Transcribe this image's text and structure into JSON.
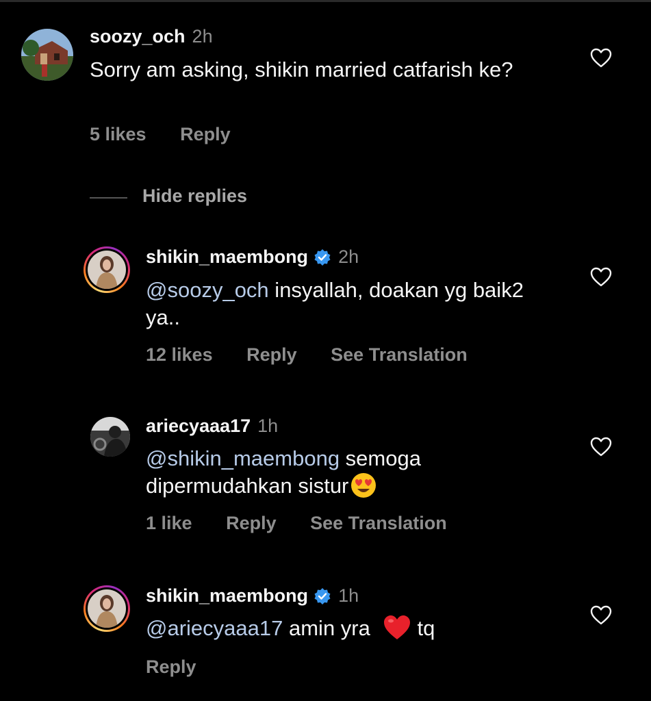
{
  "comments": [
    {
      "username": "soozy_och",
      "time": "2h",
      "text": "Sorry am asking, shikin married catfarish ke?",
      "likes": "5 likes",
      "reply": "Reply"
    },
    {
      "username": "shikin_maembong",
      "time": "2h",
      "mention": "@soozy_och",
      "text": " insyallah, doakan yg baik2 ya..",
      "likes": "12 likes",
      "reply": "Reply",
      "translate": "See Translation"
    },
    {
      "username": "ariecyaaa17",
      "time": "1h",
      "mention": "@shikin_maembong",
      "text": " semoga dipermudahkan sistur",
      "likes": "1 like",
      "reply": "Reply",
      "translate": "See Translation"
    },
    {
      "username": "shikin_maembong",
      "time": "1h",
      "mention": "@ariecyaaa17",
      "text": " amin yra",
      "text_after": "tq",
      "reply": "Reply"
    }
  ],
  "hide_replies": "Hide replies",
  "colors": {
    "background": "#000000",
    "text": "#f5f5f5",
    "muted": "#8e8e8e",
    "mention": "#b7cbe8",
    "verified": "#3897f0"
  },
  "icons": [
    "heart-outline-icon",
    "verified-badge-icon",
    "heart-eyes-emoji",
    "red-heart-emoji"
  ]
}
